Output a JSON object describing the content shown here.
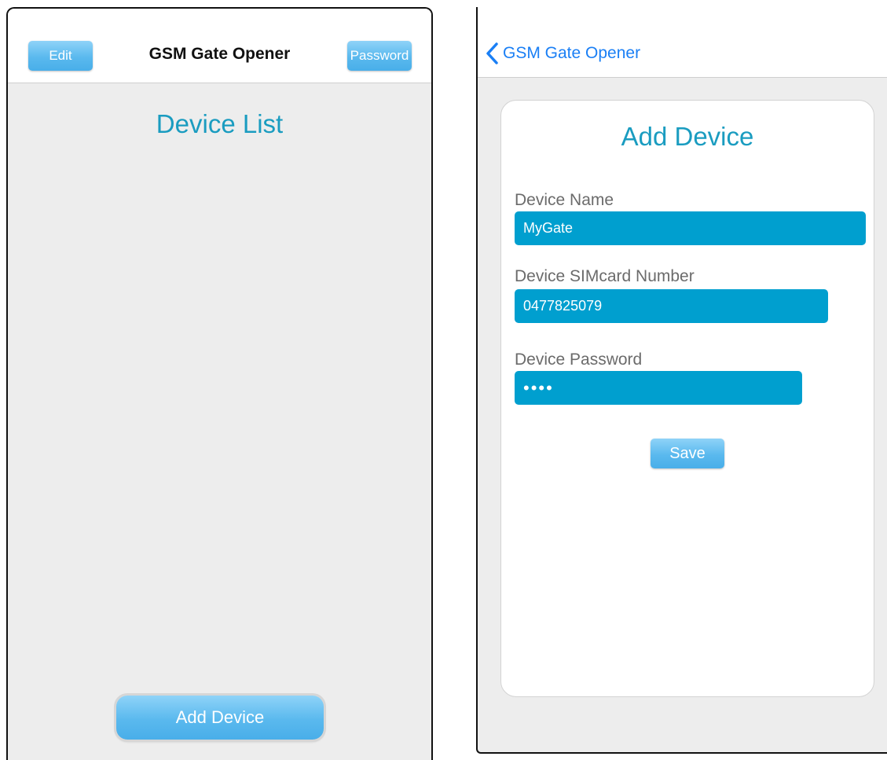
{
  "list_screen": {
    "nav": {
      "title": "GSM Gate Opener",
      "edit_label": "Edit",
      "password_label": "Password"
    },
    "heading": "Device List",
    "add_device_label": "Add Device"
  },
  "add_screen": {
    "nav": {
      "back_label": "GSM Gate Opener",
      "back_icon": "chevron-left-icon"
    },
    "heading": "Add Device",
    "fields": {
      "name_label": "Device Name",
      "name_value": "MyGate",
      "sim_label": "Device SIMcard Number",
      "sim_value": "0477825079",
      "password_label": "Device Password",
      "password_value": "••••"
    },
    "save_label": "Save"
  },
  "colors": {
    "accent_text": "#1a9cc0",
    "field_bg": "#009fcf",
    "ios_link": "#1a7ff5",
    "button_gradient_top": "#8fd3f8",
    "button_gradient_bottom": "#49aee9"
  }
}
